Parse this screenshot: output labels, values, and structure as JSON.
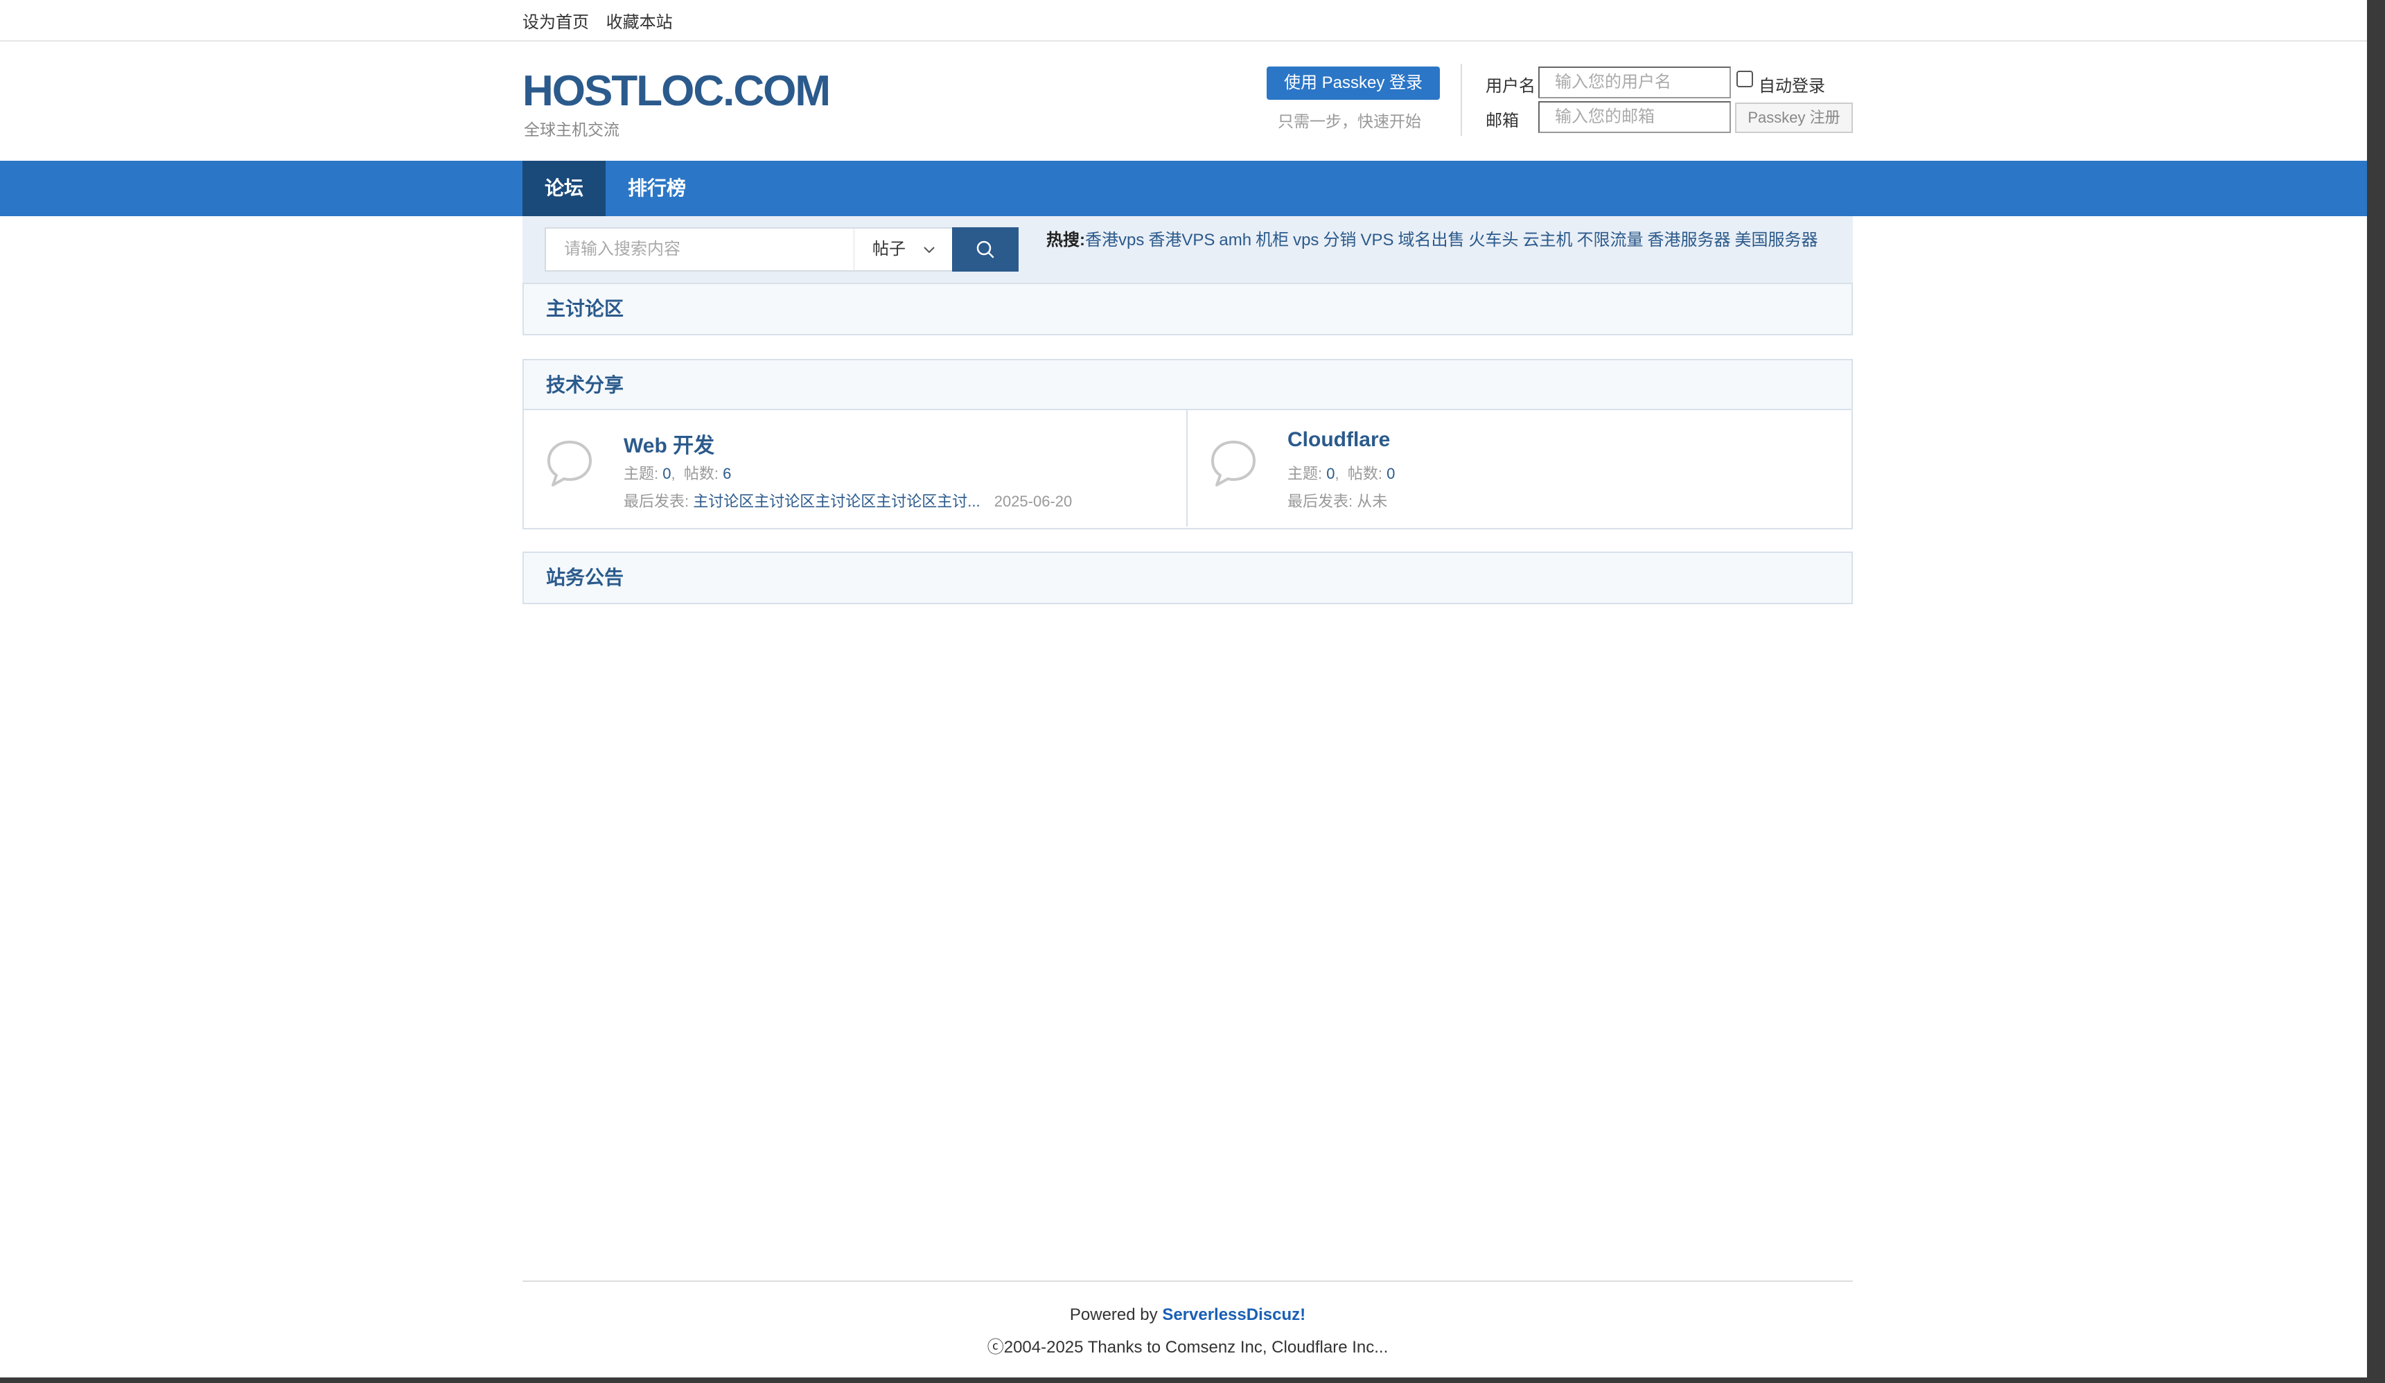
{
  "topbar": {
    "set_home": "设为首页",
    "bookmark": "收藏本站"
  },
  "header": {
    "logo": "HOSTLOC.COM",
    "slogan": "全球主机交流",
    "passkey_login": "使用 Passkey 登录",
    "passkey_hint": "只需一步，快速开始",
    "username_label": "用户名",
    "username_placeholder": "输入您的用户名",
    "auto_login_label": "自动登录",
    "email_label": "邮箱",
    "email_placeholder": "输入您的邮箱",
    "register_button": "Passkey 注册"
  },
  "nav": {
    "tabs": [
      {
        "label": "论坛",
        "active": true
      },
      {
        "label": "排行榜",
        "active": false
      }
    ]
  },
  "search": {
    "placeholder": "请输入搜索内容",
    "type_selected": "帖子",
    "hot_label": "热搜:",
    "hot_keywords": [
      "香港vps",
      "香港VPS",
      "amh",
      "机柜",
      "vps",
      "分销",
      "VPS",
      "域名出售",
      "火车头",
      "云主机",
      "不限流量",
      "香港服务器",
      "美国服务器"
    ]
  },
  "sections": [
    {
      "title": "主讨论区"
    },
    {
      "title": "技术分享",
      "forums": [
        {
          "name": "Web 开发",
          "topics_label": "主题:",
          "topics": "0",
          "posts_label": "帖数:",
          "posts": "6",
          "last_label": "最后发表:",
          "last_link": "主讨论区主讨论区主讨论区主讨论区主讨...",
          "last_date": "2025-06-20"
        },
        {
          "name": "Cloudflare",
          "topics_label": "主题:",
          "topics": "0",
          "posts_label": "帖数:",
          "posts": "0",
          "last_label": "最后发表:",
          "last_value": "从未"
        }
      ]
    },
    {
      "title": "站务公告"
    }
  ],
  "footer": {
    "powered_by": "Powered by",
    "brand": "ServerlessDiscuz!",
    "copyright": "ⓒ2004-2025 Thanks to Comsenz Inc, Cloudflare Inc..."
  },
  "colors": {
    "nav_blue": "#2b76c6",
    "nav_active": "#1a4a7a",
    "link_blue": "#2b5a8c"
  }
}
